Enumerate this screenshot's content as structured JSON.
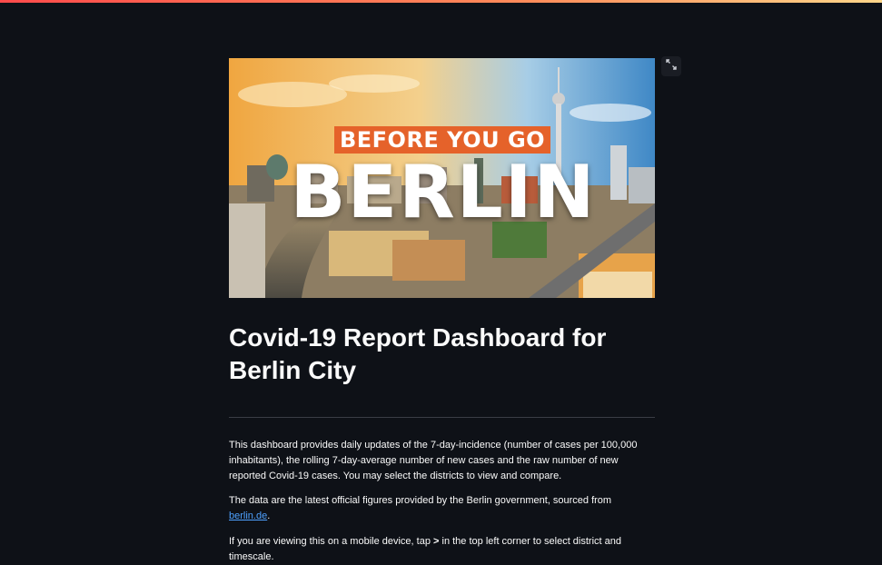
{
  "hero": {
    "tagline": "BEFORE YOU GO",
    "city": "BERLIN"
  },
  "expand_icon": "expand-icon",
  "title": "Covid-19 Report Dashboard for Berlin City",
  "paragraphs": {
    "p1": "This dashboard provides daily updates of the 7-day-incidence (number of cases per 100,000 inhabitants), the rolling 7-day-average number of new cases and the raw number of new reported Covid-19 cases. You may select the districts to view and compare.",
    "p2_prefix": "The data are the latest official figures provided by the Berlin government, sourced from ",
    "p2_link": "berlin.de",
    "p2_suffix": ".",
    "p3_prefix": "If you are viewing this on a mobile device, tap ",
    "p3_symbol": ">",
    "p3_suffix": " in the top left corner to select district and timescale."
  },
  "colors": {
    "background": "#0e1117",
    "link": "#4ea1ff",
    "tag": "#e5622a"
  }
}
